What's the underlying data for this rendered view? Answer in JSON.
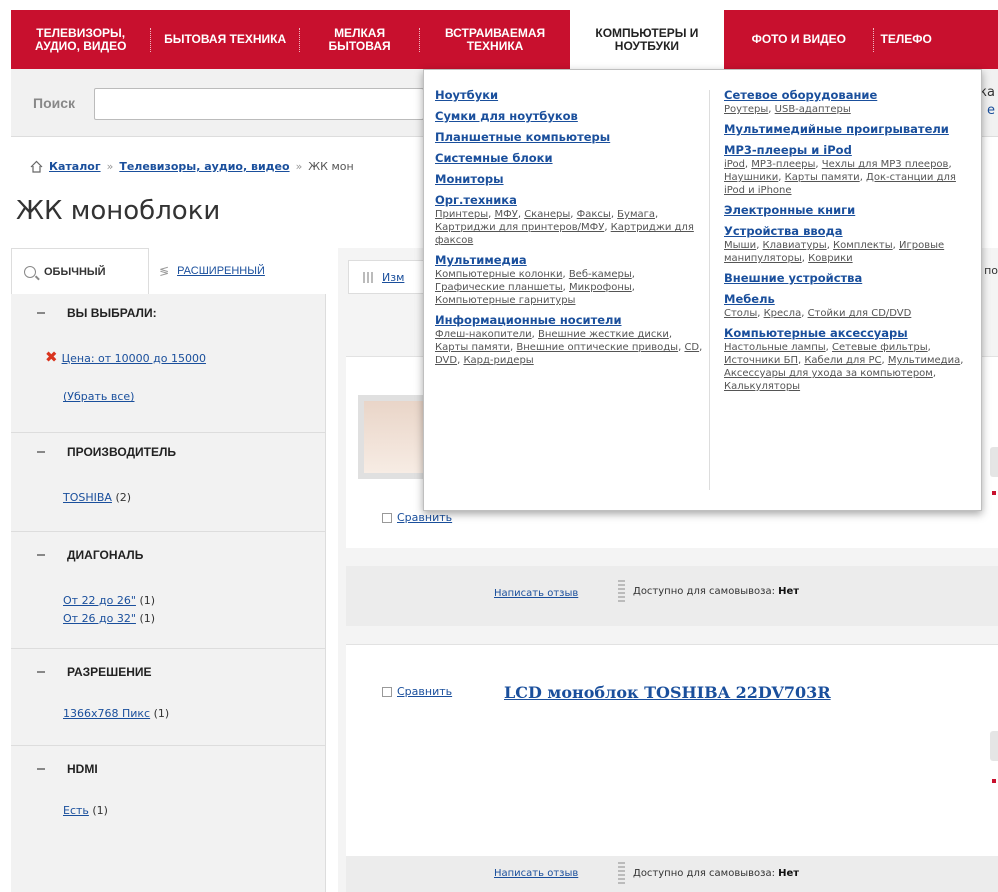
{
  "nav": {
    "items": [
      "ТЕЛЕВИЗОРЫ, АУДИО, ВИДЕО",
      "БЫТОВАЯ ТЕХНИКА",
      "МЕЛКАЯ БЫТОВАЯ",
      "ВСТРАИВАЕМАЯ ТЕХНИКА",
      "КОМПЬЮТЕРЫ И НОУТБУКИ",
      "ФОТО И ВИДЕО",
      "ТЕЛЕФО"
    ],
    "colors": {
      "primary": "#c8102e",
      "link": "#1a4f9c"
    }
  },
  "search": {
    "label": "Поиск",
    "value": "",
    "right_top": "ка",
    "right_bottom": "е"
  },
  "breadcrumb": {
    "catalog": "Каталог",
    "tv": "Телевизоры, аудио, видео",
    "current": "ЖК мон",
    "sep": "»"
  },
  "page_title": "ЖК моноблоки",
  "filter": {
    "tab_simple": "ОБЫЧНЫЙ",
    "tab_advanced": "РАСШИРЕННЫЙ",
    "selected_title": "ВЫ ВЫБРАЛИ:",
    "selected_price": "Цена:  от 10000 до 15000",
    "clear_all": "(Убрать все)",
    "maker_title": "ПРОИЗВОДИТЕЛЬ",
    "maker_value": "TOSHIBA",
    "maker_count": "(2)",
    "diag_title": "ДИАГОНАЛЬ",
    "diag_1": "От 22 до 26\"",
    "diag_1_count": "(1)",
    "diag_2": "От 26 до 32\"",
    "diag_2_count": "(1)",
    "res_title": "РАЗРЕШЕНИЕ",
    "res_value": "1366x768 Пикс",
    "res_count": "(1)",
    "hdmi_title": "HDMI",
    "hdmi_value": "Есть",
    "hdmi_count": "(1)"
  },
  "content": {
    "view_tab": "Изм",
    "right_text": "по",
    "compare": "Сравнить",
    "write_review": "Написать отзыв",
    "pickup_label": "Доступно для самовывоза:",
    "pickup_value": "Нет",
    "product_title": "LCD моноблок TOSHIBA 22DV703R"
  },
  "dropdown": {
    "left": [
      {
        "title": "Ноутбуки",
        "subs": []
      },
      {
        "title": "Сумки для ноутбуков",
        "subs": []
      },
      {
        "title": "Планшетные компьютеры",
        "subs": []
      },
      {
        "title": "Системные блоки",
        "subs": []
      },
      {
        "title": "Мониторы",
        "subs": []
      },
      {
        "title": "Орг.техника",
        "subs": [
          "Принтеры",
          "МФУ",
          "Сканеры",
          "Факсы",
          "Бумага",
          "Картриджи для принтеров/МФУ",
          "Картриджи для факсов"
        ]
      },
      {
        "title": "Мультимедиа",
        "subs": [
          "Компьютерные колонки",
          "Веб-камеры",
          "Графические планшеты",
          "Микрофоны",
          "Компьютерные гарнитуры"
        ]
      },
      {
        "title": "Информационные носители",
        "subs": [
          "Флеш-накопители",
          "Внешние жесткие диски",
          "Карты памяти",
          "Внешние оптические приводы",
          "CD",
          "DVD",
          "Кард-ридеры"
        ]
      }
    ],
    "right": [
      {
        "title": "Сетевое оборудование",
        "subs": [
          "Роутеры",
          "USB-адаптеры"
        ]
      },
      {
        "title": "Мультимедийные проигрыватели",
        "subs": []
      },
      {
        "title": "MP3-плееры и iPod",
        "subs": [
          "iPod",
          "MP3-плееры",
          "Чехлы для MP3 плееров",
          "Наушники",
          "Карты памяти",
          "Док-станции для iPod и iPhone"
        ]
      },
      {
        "title": "Электронные книги",
        "subs": []
      },
      {
        "title": "Устройства ввода",
        "subs": [
          "Мыши",
          "Клавиатуры",
          "Комплекты",
          "Игровые манипуляторы",
          "Коврики"
        ]
      },
      {
        "title": "Внешние устройства",
        "subs": []
      },
      {
        "title": "Мебель",
        "subs": [
          "Столы",
          "Кресла",
          "Стойки для CD/DVD"
        ]
      },
      {
        "title": "Компьютерные аксессуары",
        "subs": [
          "Настольные лампы",
          "Сетевые фильтры",
          "Источники БП",
          "Кабели для PC",
          "Мультимедиа",
          "Аксессуары для ухода за компьютером",
          "Калькуляторы"
        ]
      }
    ]
  }
}
